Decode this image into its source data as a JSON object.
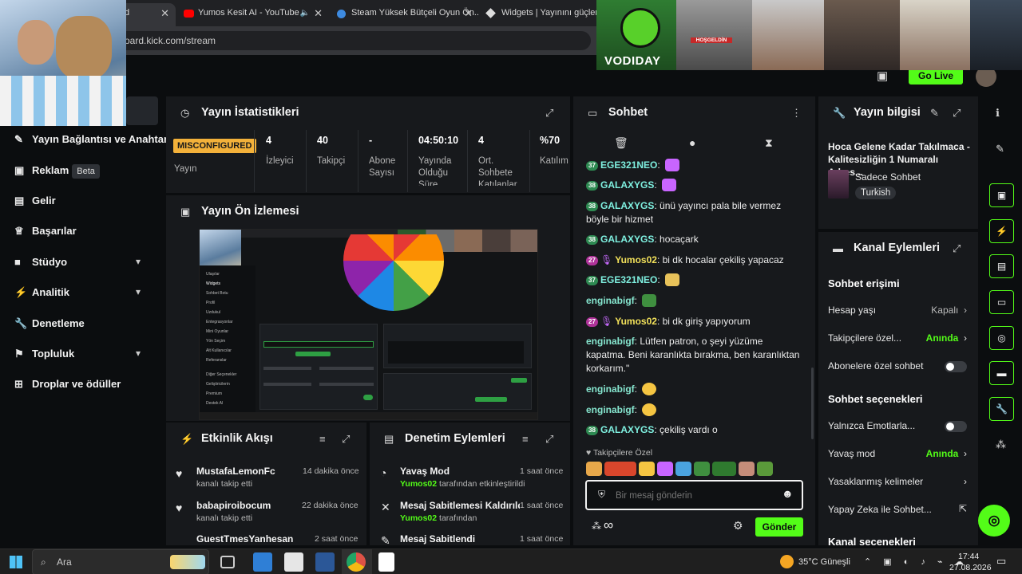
{
  "browser": {
    "tabs": [
      {
        "title": "d"
      },
      {
        "title": "Yumos Kesit AI - YouTube"
      },
      {
        "title": "Steam Yüksek Bütçeli Oyun Ön..."
      },
      {
        "title": "Widgets | Yayınını güçlendir"
      }
    ],
    "url": "oard.kick.com/stream"
  },
  "topbar": {
    "go_live": "Go Live"
  },
  "overlay": {
    "vodiday": "VODIDAY",
    "banner": "HOŞGELDİN"
  },
  "sidebar": {
    "items": [
      {
        "label": "Yayın Bağlantısı ve Anahtar"
      },
      {
        "label": "Reklam",
        "badge": "Beta"
      },
      {
        "label": "Gelir"
      },
      {
        "label": "Başarılar"
      },
      {
        "label": "Stüdyo"
      },
      {
        "label": "Analitik"
      },
      {
        "label": "Denetleme"
      },
      {
        "label": "Topluluk"
      },
      {
        "label": "Droplar ve ödüller"
      }
    ]
  },
  "stats": {
    "title": "Yayın İstatistikleri",
    "status": "MISCONFIGURED",
    "status_label": "Yayın",
    "items": [
      {
        "value": "4",
        "label": "İzleyici"
      },
      {
        "value": "40",
        "label": "Takipçi"
      },
      {
        "value": "-",
        "label": "Abone Sayısı"
      },
      {
        "value": "04:50:10",
        "label": "Yayında Olduğu Süre"
      },
      {
        "value": "4",
        "label": "Ort. Sohbete Katılanlar"
      },
      {
        "value": "%70",
        "label": "Katılım"
      }
    ]
  },
  "preview": {
    "title": "Yayın Ön İzlemesi"
  },
  "activity": {
    "title": "Etkinlik Akışı",
    "items": [
      {
        "user": "MustafaLemonFc",
        "action": "kanalı takip etti",
        "time": "14 dakika önce"
      },
      {
        "user": "babapiroibocum",
        "action": "kanalı takip etti",
        "time": "22 dakika önce"
      },
      {
        "user": "GuestTmesYanhesan",
        "action": "",
        "time": "2 saat önce"
      }
    ]
  },
  "moderation": {
    "title": "Denetim Eylemleri",
    "items": [
      {
        "title": "Yavaş Mod",
        "actor": "Yumos02",
        "suffix": "tarafından etkinleştirildi",
        "time": "1 saat önce"
      },
      {
        "title": "Mesaj Sabitlemesi Kaldırıldı",
        "actor": "Yumos02",
        "suffix": "tarafından",
        "time": "1 saat önce"
      },
      {
        "title": "Mesaj Sabitlendi",
        "actor": "",
        "suffix": "",
        "time": "1 saat önce"
      }
    ]
  },
  "chat": {
    "title": "Sohbet",
    "messages": [
      {
        "badge": "37",
        "user": "EGE321NEO",
        "text": ""
      },
      {
        "badge": "38",
        "user": "GALAXYGS",
        "text": ""
      },
      {
        "badge": "38",
        "user": "GALAXYGS",
        "text": "ünü yayıncı pala bile vermez böyle bir hizmet"
      },
      {
        "badge": "38",
        "user": "GALAXYGS",
        "text": "hocaçark"
      },
      {
        "badge": "27",
        "user": "Yumos02",
        "text": "bi dk hocalar çekiliş yapacaz"
      },
      {
        "badge": "37",
        "user": "EGE321NEO",
        "text": ""
      },
      {
        "badge": "",
        "user": "enginabigf",
        "text": ""
      },
      {
        "badge": "27",
        "user": "Yumos02",
        "text": "bi dk giriş yapıyorum"
      },
      {
        "badge": "",
        "user": "enginabigf",
        "text": "Lütfen patron, o şeyi yüzüme kapatma. Beni karanlıkta bırakma, ben karanlıktan korkarım.\""
      },
      {
        "badge": "",
        "user": "enginabigf",
        "text": ""
      },
      {
        "badge": "",
        "user": "enginabigf",
        "text": ""
      },
      {
        "badge": "38",
        "user": "GALAXYGS",
        "text": "çekiliş vardı o"
      }
    ],
    "followers_only": "Takipçilere Özel",
    "input_placeholder": "Bir mesaj gönderin",
    "infinity": "∞",
    "send": "Gönder"
  },
  "stream_info": {
    "title": "Yayın bilgisi",
    "stream_title": "Hoca Gelene Kadar Takılmaca - Kalitesizliğin 1 Numaralı Adres...",
    "category": "Sadece Sohbet",
    "language": "Turkish"
  },
  "channel_actions": {
    "title": "Kanal Eylemleri",
    "chat_access": "Sohbet erişimi",
    "rows_access": [
      {
        "label": "Hesap yaşı",
        "value": "Kapalı"
      },
      {
        "label": "Takipçilere özel...",
        "value": "Anında"
      },
      {
        "label": "Abonelere özel sohbet",
        "value": ""
      }
    ],
    "chat_options": "Sohbet seçenekleri",
    "rows_options": [
      {
        "label": "Yalnızca Emotlarla...",
        "value": ""
      },
      {
        "label": "Yavaş mod",
        "value": "Anında"
      },
      {
        "label": "Yasaklanmış kelimeler",
        "value": ""
      },
      {
        "label": "Yapay Zeka ile Sohbet...",
        "value": ""
      }
    ],
    "channel_options": "Kanal seçenekleri"
  },
  "taskbar": {
    "search": "Ara",
    "weather": "35°C Güneşli",
    "time": "17:44",
    "date": "27.08.2026"
  },
  "colors": {
    "accent": "#53fc18",
    "panel": "#17191c",
    "bg": "#0b0d0f",
    "warning": "#f3b13a"
  }
}
